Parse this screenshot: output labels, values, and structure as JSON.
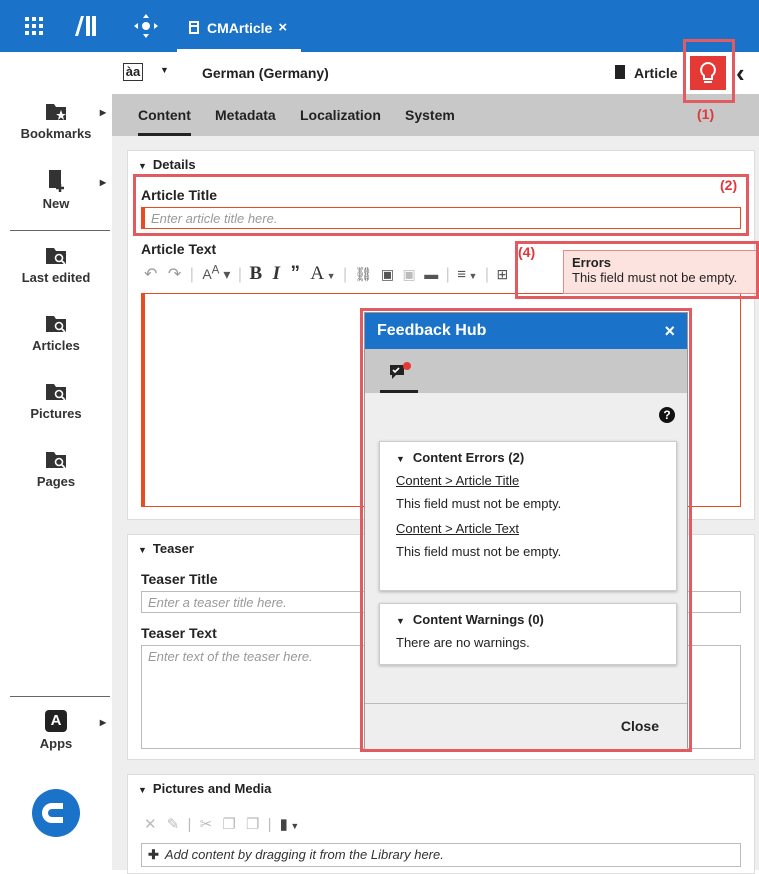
{
  "topbar": {
    "doc_tab_label": "CMArticle",
    "doc_tab_close": "×"
  },
  "subheader": {
    "locale": "German (Germany)",
    "type_label": "Article"
  },
  "nav": {
    "items": [
      {
        "label": "Bookmarks",
        "icon": "bookmarks-folder-icon"
      },
      {
        "label": "New",
        "icon": "new-document-icon"
      },
      {
        "label": "Last edited",
        "icon": "folder-search-icon"
      },
      {
        "label": "Articles",
        "icon": "folder-search-icon"
      },
      {
        "label": "Pictures",
        "icon": "folder-search-icon"
      },
      {
        "label": "Pages",
        "icon": "folder-search-icon"
      },
      {
        "label": "Apps",
        "icon": "apps-icon"
      }
    ]
  },
  "tabs": [
    "Content",
    "Metadata",
    "Localization",
    "System"
  ],
  "details": {
    "header": "Details",
    "article_title_label": "Article Title",
    "article_title_placeholder": "Enter article title here.",
    "article_text_label": "Article Text"
  },
  "teaser": {
    "header": "Teaser",
    "title_label": "Teaser Title",
    "title_placeholder": "Enter a teaser title here.",
    "text_label": "Teaser Text",
    "text_placeholder": "Enter text of the teaser here."
  },
  "pictures": {
    "header": "Pictures and Media",
    "drop_hint": "Add content by dragging it from the Library here."
  },
  "tooltip": {
    "title": "Errors",
    "message": "This field must not be empty."
  },
  "feedback_hub": {
    "title": "Feedback Hub",
    "close_x": "×",
    "help": "?",
    "errors_header": "Content Errors (2)",
    "errors": [
      {
        "link": "Content > Article Title",
        "message": "This field must not be empty."
      },
      {
        "link": "Content > Article Text",
        "message": "This field must not be empty."
      }
    ],
    "warnings_header": "Content Warnings (0)",
    "warnings_message": "There are no warnings.",
    "close_button": "Close"
  },
  "annotations": {
    "a1": "(1)",
    "a2": "(2)",
    "a4": "(4)"
  },
  "colors": {
    "brand_blue": "#1a73c8",
    "error_red": "#e53935",
    "annotation_red": "#e25b60"
  }
}
